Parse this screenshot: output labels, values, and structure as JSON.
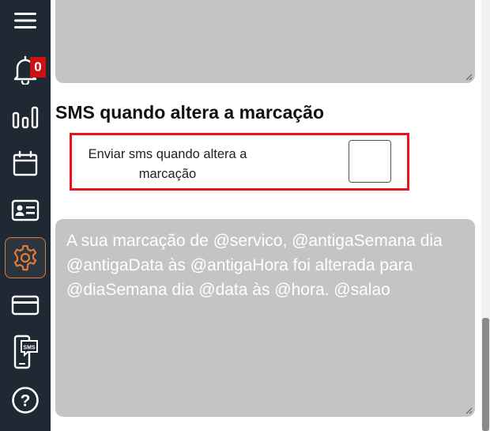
{
  "sidebar": {
    "items": [
      {
        "icon": "menu-icon"
      },
      {
        "icon": "bell-icon",
        "badge": "0"
      },
      {
        "icon": "bar-chart-icon"
      },
      {
        "icon": "calendar-icon"
      },
      {
        "icon": "id-card-icon"
      },
      {
        "icon": "gear-icon",
        "active": true
      },
      {
        "icon": "credit-card-icon"
      },
      {
        "icon": "sms-phone-icon",
        "label": "SMS"
      },
      {
        "icon": "help-icon",
        "label": "?"
      }
    ],
    "accent_color": "#e07b39",
    "background_color": "#1f2933",
    "badge_color": "#cc1111"
  },
  "section": {
    "title": "SMS quando altera a marcação",
    "option_label": "Enviar sms quando altera a marcação",
    "checkbox_checked": false,
    "highlight_color": "#e8141c"
  },
  "message_template": {
    "value": "A sua marcação de @servico, @antigaSemana dia @antigaData às @antigaHora foi alterada para @diaSemana dia @data às @hora. @salao"
  }
}
